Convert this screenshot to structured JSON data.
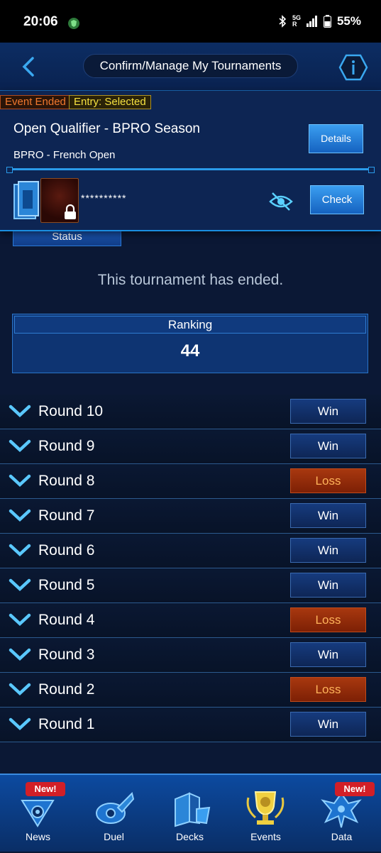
{
  "status_bar": {
    "time": "20:06",
    "network": "5G",
    "roaming": "R",
    "battery": "55%"
  },
  "header": {
    "title": "Confirm/Manage My Tournaments"
  },
  "tournament": {
    "tag_event": "Event Ended",
    "tag_entry": "Entry: Selected",
    "name": "Open Qualifier - BPRO Season",
    "subtitle": "BPRO - French Open",
    "details_label": "Details",
    "deck_code": "**********",
    "check_label": "Check"
  },
  "status_tab_label": "Status",
  "ended_message": "This tournament has ended.",
  "ranking": {
    "label": "Ranking",
    "value": "44"
  },
  "rounds": [
    {
      "label": "Round 10",
      "result": "Win"
    },
    {
      "label": "Round 9",
      "result": "Win"
    },
    {
      "label": "Round 8",
      "result": "Loss"
    },
    {
      "label": "Round 7",
      "result": "Win"
    },
    {
      "label": "Round 6",
      "result": "Win"
    },
    {
      "label": "Round 5",
      "result": "Win"
    },
    {
      "label": "Round 4",
      "result": "Loss"
    },
    {
      "label": "Round 3",
      "result": "Win"
    },
    {
      "label": "Round 2",
      "result": "Loss"
    },
    {
      "label": "Round 1",
      "result": "Win"
    }
  ],
  "nav": {
    "news": "News",
    "duel": "Duel",
    "decks": "Decks",
    "events": "Events",
    "data": "Data",
    "new_badge": "New!"
  },
  "colors": {
    "accent": "#2a9bea",
    "loss": "#a8380f",
    "win": "#163b7e"
  }
}
